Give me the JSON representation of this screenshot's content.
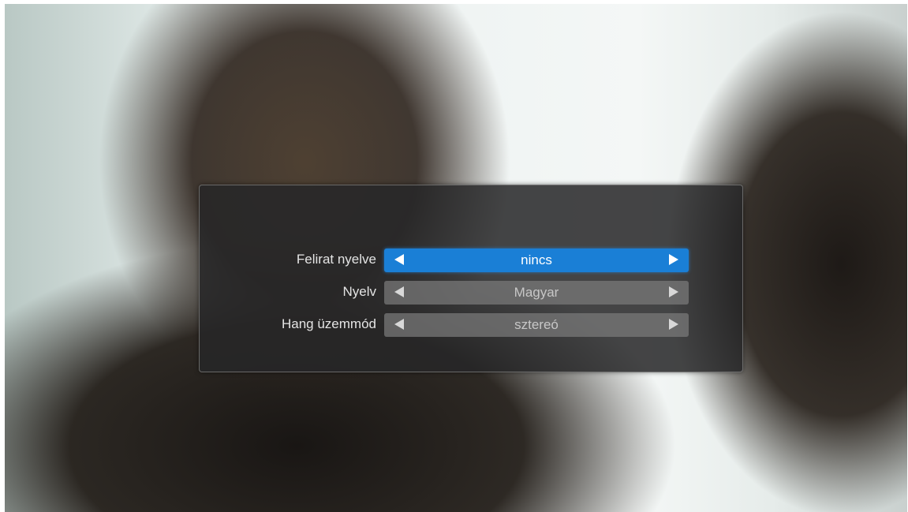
{
  "settings": {
    "rows": [
      {
        "label": "Felirat nyelve",
        "value": "nincs"
      },
      {
        "label": "Nyelv",
        "value": "Magyar"
      },
      {
        "label": "Hang üzemmód",
        "value": "sztereó"
      }
    ],
    "selected_index": 0
  },
  "colors": {
    "accent": "#1a7fd6",
    "panel": "#262628"
  }
}
